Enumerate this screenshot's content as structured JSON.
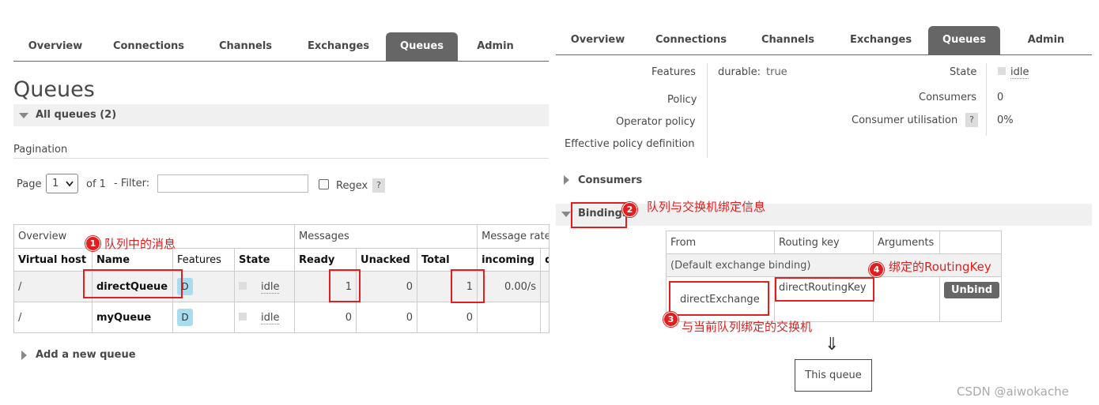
{
  "left": {
    "nav": [
      "Overview",
      "Connections",
      "Channels",
      "Exchanges",
      "Queues",
      "Admin"
    ],
    "active_tab": "Queues",
    "page_title": "Queues",
    "all_queues_label": "All queues (2)",
    "pagination_label": "Pagination",
    "page_label": "Page",
    "page_value": "1",
    "of_label": "of 1",
    "filter_label": "- Filter:",
    "filter_value": "",
    "regex_label": "Regex",
    "help": "?",
    "table": {
      "group_overview": "Overview",
      "group_messages": "Messages",
      "group_rates": "Message rate",
      "columns": [
        "Virtual host",
        "Name",
        "Features",
        "State",
        "Ready",
        "Unacked",
        "Total",
        "incoming",
        "d"
      ],
      "rows": [
        {
          "vhost": "/",
          "name": "directQueue",
          "feature": "D",
          "state": "idle",
          "ready": "1",
          "unacked": "0",
          "total": "1",
          "incoming": "0.00/s"
        },
        {
          "vhost": "/",
          "name": "myQueue",
          "feature": "D",
          "state": "idle",
          "ready": "0",
          "unacked": "0",
          "total": "0",
          "incoming": ""
        }
      ]
    },
    "add_queue": "Add a new queue",
    "annotation_1": "队列中的消息"
  },
  "right": {
    "nav": [
      "Overview",
      "Connections",
      "Channels",
      "Exchanges",
      "Queues",
      "Admin"
    ],
    "active_tab": "Queues",
    "features_label": "Features",
    "durable_key": "durable:",
    "durable_value": "true",
    "policy_label": "Policy",
    "operator_policy_label": "Operator policy",
    "effective_policy_label": "Effective policy definition",
    "state_label": "State",
    "state_value": "idle",
    "consumers_label": "Consumers",
    "consumers_value": "0",
    "utilisation_label": "Consumer utilisation",
    "utilisation_value": "0%",
    "help": "?",
    "consumers_section": "Consumers",
    "bindings_section": "Bindings",
    "binding_table": {
      "headers": [
        "From",
        "Routing key",
        "Arguments"
      ],
      "default_binding": "(Default exchange binding)",
      "from": "directExchange",
      "routing_key": "directRoutingKey",
      "unbind": "Unbind"
    },
    "arrow": "⇓",
    "this_queue": "This queue",
    "annotation_2": "队列与交换机绑定信息",
    "annotation_3": "与当前队列绑定的交换机",
    "annotation_4": "绑定的RoutingKey"
  },
  "watermark": "CSDN @aiwokache",
  "marker_numbers": [
    "1",
    "2",
    "3",
    "4"
  ]
}
